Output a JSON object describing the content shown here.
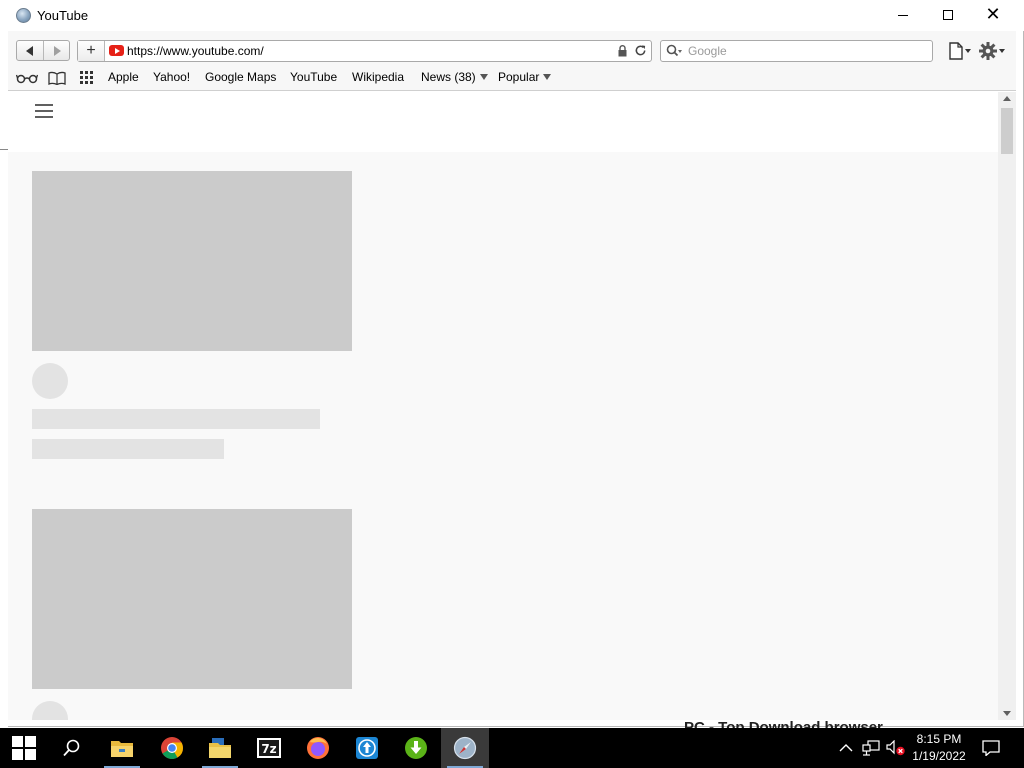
{
  "window": {
    "title": "YouTube",
    "controls": {
      "minimize": "minimize",
      "maximize": "maximize",
      "close": "close"
    }
  },
  "toolbar": {
    "back": "back-arrow",
    "forward": "forward-arrow",
    "new_tab": "+",
    "url": "https://www.youtube.com/",
    "search_placeholder": "Google"
  },
  "bookmarks": {
    "items": [
      "Apple",
      "Yahoo!",
      "Google Maps",
      "YouTube",
      "Wikipedia",
      "News (38)",
      "Popular"
    ]
  },
  "desktop": {
    "behind_text": "PC - Top Download browser"
  },
  "taskbar": {
    "apps": [
      "file-explorer",
      "chrome",
      "file-manager",
      "7-zip",
      "firefox",
      "uploader",
      "downloader",
      "browser"
    ],
    "time": "8:15 PM",
    "date": "1/19/2022"
  },
  "colors": {
    "page_bg": "#f9f9f9",
    "skeleton_thumb": "#cbcbcb",
    "skeleton_line": "#e3e3e3",
    "youtube_red": "#e62117",
    "taskbar": "#000000"
  }
}
